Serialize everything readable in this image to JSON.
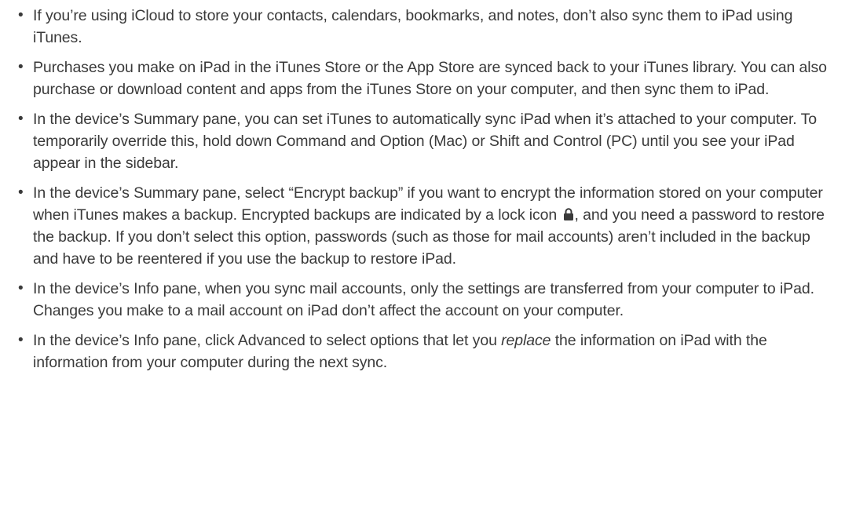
{
  "bullet_char": "•",
  "items": [
    {
      "text": "If you’re using iCloud to store your contacts, calendars, bookmarks, and notes, don’t also sync them to iPad using iTunes."
    },
    {
      "text": "Purchases you make on iPad in the iTunes Store or the App Store are synced back to your iTunes library. You can also purchase or download content and apps from the iTunes Store on your computer, and then sync them to iPad."
    },
    {
      "text": "In the device’s Summary pane, you can set iTunes to automatically sync iPad when it’s attached to your computer. To temporarily override this, hold down Command and Option (Mac) or Shift and Control (PC) until you see your iPad appear in the sidebar."
    },
    {
      "text_before_icon": "In the device’s Summary pane, select “Encrypt backup” if you want to encrypt the information stored on your computer when iTunes makes a backup. Encrypted backups are indicated by a lock icon ",
      "icon": "lock-icon",
      "text_after_icon": ", and you need a password to restore the backup. If you don’t select this option, passwords (such as those for mail accounts) aren’t included in the backup and have to be reentered if you use the backup to restore iPad."
    },
    {
      "text": "In the device’s Info pane, when you sync mail accounts, only the settings are transferred from your computer to iPad. Changes you make to a mail account on iPad don’t affect the account on your computer."
    },
    {
      "text_before_em": "In the device’s Info pane, click Advanced to select options that let you ",
      "em": "replace",
      "text_after_em": " the information on iPad with the information from your computer during the next sync."
    }
  ]
}
